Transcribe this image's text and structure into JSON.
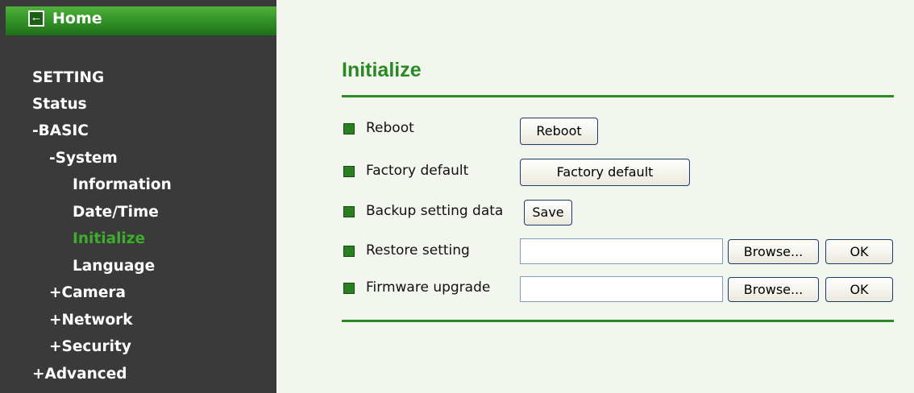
{
  "nav": {
    "home": "Home",
    "setting": "SETTING",
    "status": "Status",
    "basic": "-BASIC",
    "system": "-System",
    "information": "Information",
    "datetime": "Date/Time",
    "initialize": "Initialize",
    "language": "Language",
    "camera": "+Camera",
    "network": "+Network",
    "security": "+Security",
    "advanced": "+Advanced"
  },
  "page": {
    "title": "Initialize",
    "reboot_label": "Reboot",
    "reboot_button": "Reboot",
    "factory_label": "Factory default",
    "factory_button": "Factory default",
    "backup_label": "Backup setting data",
    "save_button": "Save",
    "restore_label": "Restore setting",
    "restore_value": "",
    "restore_browse": "Browse...",
    "restore_ok": "OK",
    "firmware_label": "Firmware upgrade",
    "firmware_value": "",
    "firmware_browse": "Browse...",
    "firmware_ok": "OK"
  },
  "colors": {
    "sidebar_bg": "#3a3a3a",
    "home_bar": "#2f8f26",
    "active_nav": "#3cae2c",
    "title": "#2a8a22",
    "main_bg": "#f3f6ee"
  },
  "icons": {
    "home": "back-arrow-icon",
    "bullet": "green-square-icon"
  }
}
